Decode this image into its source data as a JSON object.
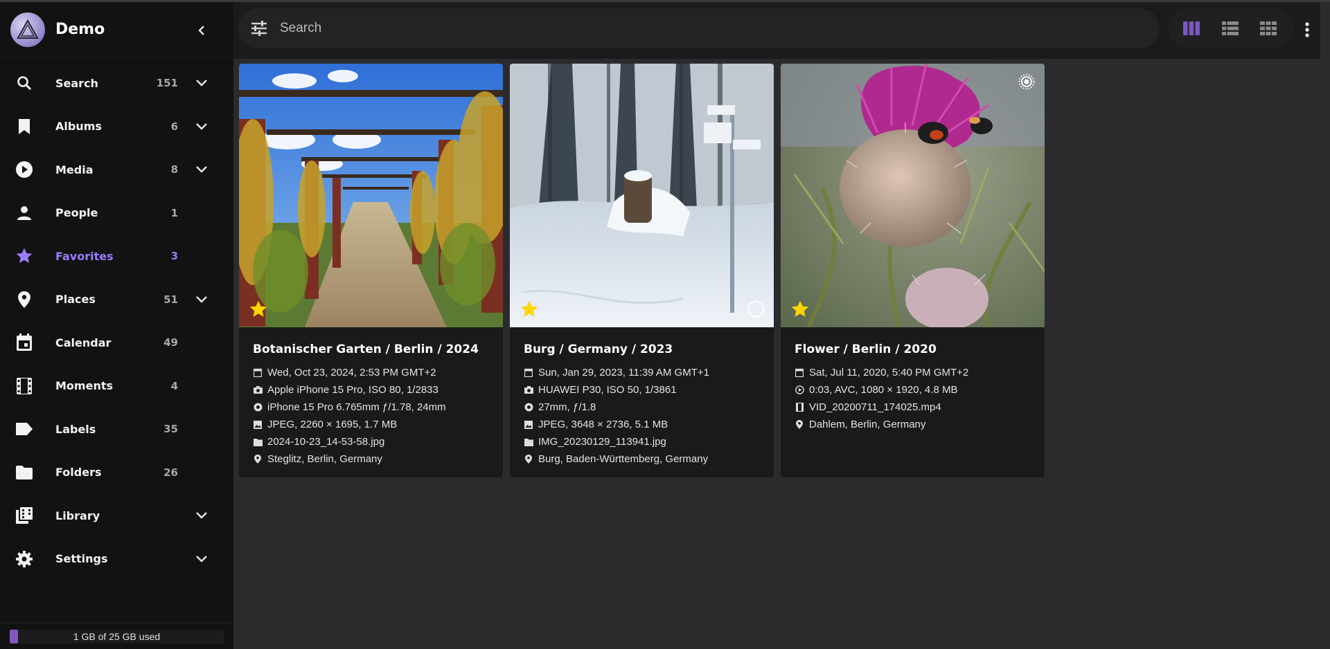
{
  "app": {
    "title": "Demo"
  },
  "sidebar": {
    "items": [
      {
        "label": "Search",
        "count": "151",
        "icon": "search-icon",
        "expandable": true
      },
      {
        "label": "Albums",
        "count": "6",
        "icon": "bookmark-icon",
        "expandable": true
      },
      {
        "label": "Media",
        "count": "8",
        "icon": "play-circle-icon",
        "expandable": true
      },
      {
        "label": "People",
        "count": "1",
        "icon": "person-icon",
        "expandable": false
      },
      {
        "label": "Favorites",
        "count": "3",
        "icon": "star-icon",
        "expandable": false,
        "active": true
      },
      {
        "label": "Places",
        "count": "51",
        "icon": "location-pin-icon",
        "expandable": true
      },
      {
        "label": "Calendar",
        "count": "49",
        "icon": "calendar-icon",
        "expandable": false
      },
      {
        "label": "Moments",
        "count": "4",
        "icon": "film-icon",
        "expandable": false
      },
      {
        "label": "Labels",
        "count": "35",
        "icon": "label-icon",
        "expandable": false
      },
      {
        "label": "Folders",
        "count": "26",
        "icon": "folder-icon",
        "expandable": false
      },
      {
        "label": "Library",
        "count": "",
        "icon": "library-icon",
        "expandable": true
      },
      {
        "label": "Settings",
        "count": "",
        "icon": "gear-icon",
        "expandable": true
      }
    ],
    "storage": {
      "text": "1 GB of 25 GB used",
      "used_fraction": 0.04
    }
  },
  "toolbar": {
    "search_placeholder": "Search",
    "views": [
      "cards-view-icon",
      "list-view-icon",
      "mosaic-view-icon"
    ],
    "active_view": "cards-view-icon"
  },
  "colors": {
    "accent": "#9b7bff",
    "star": "#ffd600",
    "sidebar_bg": "#121212",
    "content_bg": "#2b2b2d",
    "card_bg": "#1a1a1a"
  },
  "cards": [
    {
      "title": "Botanischer Garten / Berlin / 2024",
      "favorite": true,
      "meta": [
        {
          "icon": "calendar-icon",
          "text": "Wed, Oct 23, 2024, 2:53 PM GMT+2"
        },
        {
          "icon": "camera-icon",
          "text": "Apple iPhone 15 Pro, ISO 80, 1/2833"
        },
        {
          "icon": "lens-icon",
          "text": "iPhone 15 Pro 6.765mm ƒ/1.78, 24mm"
        },
        {
          "icon": "image-icon",
          "text": "JPEG, 2260 × 1695, 1.7 MB"
        },
        {
          "icon": "file-icon",
          "text": "2024-10-23_14-53-58.jpg"
        },
        {
          "icon": "location-pin-icon",
          "text": "Steglitz, Berlin, Germany"
        }
      ]
    },
    {
      "title": "Burg / Germany / 2023",
      "favorite": true,
      "meta": [
        {
          "icon": "calendar-icon",
          "text": "Sun, Jan 29, 2023, 11:39 AM GMT+1"
        },
        {
          "icon": "camera-icon",
          "text": "HUAWEI P30, ISO 50, 1/3861"
        },
        {
          "icon": "lens-icon",
          "text": "27mm, ƒ/1.8"
        },
        {
          "icon": "image-icon",
          "text": "JPEG, 3648 × 2736, 5.1 MB"
        },
        {
          "icon": "file-icon",
          "text": "IMG_20230129_113941.jpg"
        },
        {
          "icon": "location-pin-icon",
          "text": "Burg, Baden-Württemberg, Germany"
        }
      ]
    },
    {
      "title": "Flower / Berlin / 2020",
      "favorite": true,
      "meta": [
        {
          "icon": "calendar-icon",
          "text": "Sat, Jul 11, 2020, 5:40 PM GMT+2"
        },
        {
          "icon": "play-circle-icon",
          "text": "0:03, AVC, 1080 × 1920, 4.8 MB"
        },
        {
          "icon": "film-icon",
          "text": "VID_20200711_174025.mp4"
        },
        {
          "icon": "location-pin-icon",
          "text": "Dahlem, Berlin, Germany"
        }
      ]
    }
  ]
}
